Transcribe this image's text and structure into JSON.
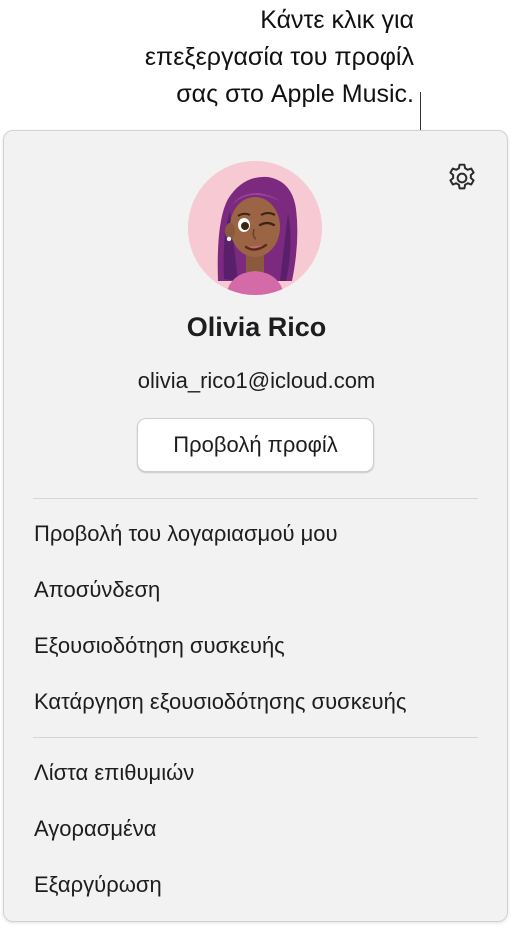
{
  "callout": {
    "text": "Κάντε κλικ για\nεπεξεργασία του προφίλ\nσας στο Apple Music."
  },
  "profile": {
    "name": "Olivia Rico",
    "email": "olivia_rico1@icloud.com",
    "view_profile_label": "Προβολή προφίλ",
    "avatar_bg": "#f6c9d3"
  },
  "icons": {
    "settings": "gear-icon"
  },
  "menu": {
    "account": [
      "Προβολή του λογαριασμού μου",
      "Αποσύνδεση",
      "Εξουσιοδότηση συσκευής",
      "Κατάργηση εξουσιοδότησης συσκευής"
    ],
    "store": [
      "Λίστα επιθυμιών",
      "Αγορασμένα",
      "Εξαργύρωση"
    ]
  }
}
